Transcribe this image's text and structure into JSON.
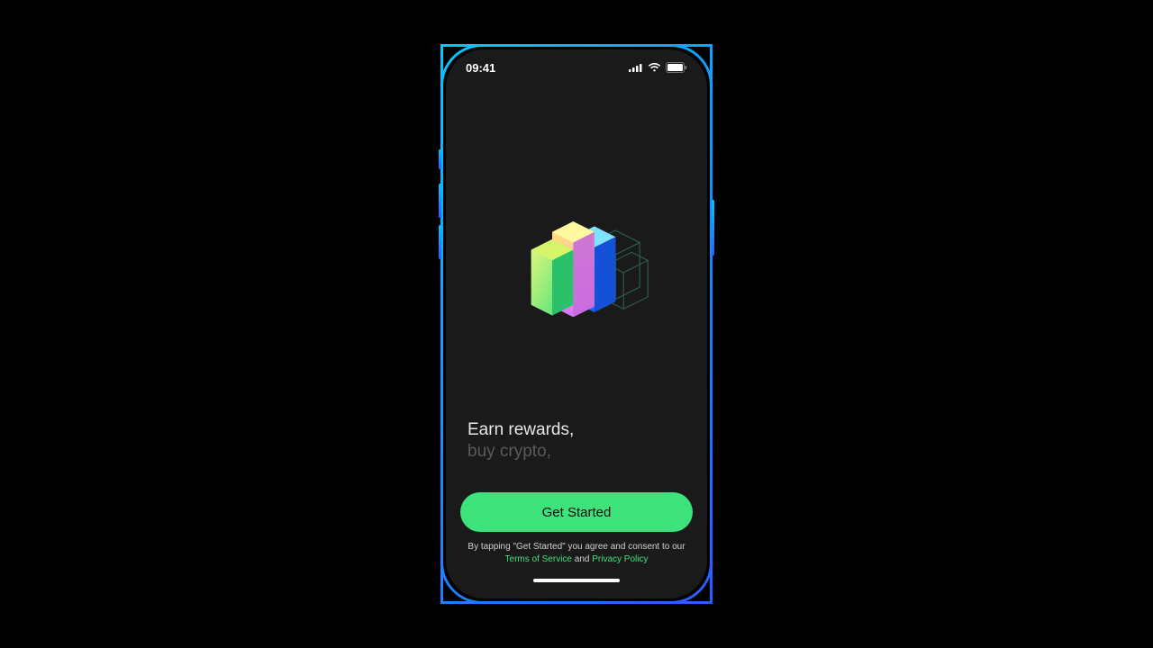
{
  "status": {
    "time": "09:41"
  },
  "taglines": {
    "primary": "Earn rewards,",
    "secondary": "buy crypto,"
  },
  "cta": {
    "label": "Get Started"
  },
  "legal": {
    "prefix": "By tapping \"Get Started\" you agree and consent to our",
    "terms_label": "Terms of Service",
    "and": " and ",
    "privacy_label": "Privacy Policy"
  },
  "colors": {
    "accent_green": "#3ee27a",
    "frame_gradient_start": "#00c8ff",
    "frame_gradient_end": "#2b5cff"
  }
}
